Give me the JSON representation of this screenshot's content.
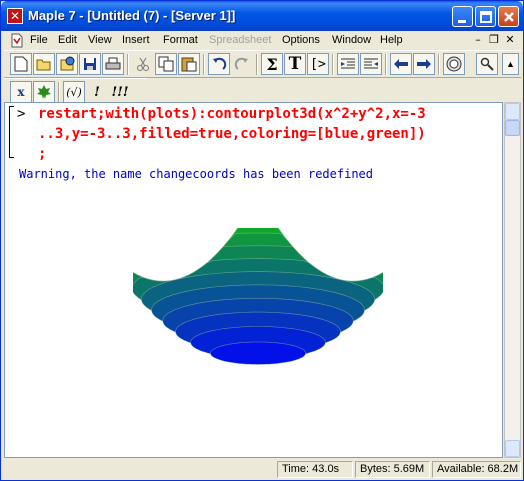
{
  "window": {
    "title": "Maple 7  - [Untitled (7) - [Server 1]]",
    "app_icon": "maple-leaf-icon",
    "title_color": "#0058e6"
  },
  "menu": {
    "items": [
      {
        "label": "File",
        "enabled": true
      },
      {
        "label": "Edit",
        "enabled": true
      },
      {
        "label": "View",
        "enabled": true
      },
      {
        "label": "Insert",
        "enabled": true
      },
      {
        "label": "Format",
        "enabled": true
      },
      {
        "label": "Spreadsheet",
        "enabled": false
      },
      {
        "label": "Options",
        "enabled": true
      },
      {
        "label": "Window",
        "enabled": true
      },
      {
        "label": "Help",
        "enabled": true
      }
    ]
  },
  "toolbar2": {
    "labels": [
      "x",
      "(√)",
      "!",
      "!!!"
    ]
  },
  "worksheet": {
    "prompt": ">",
    "command_lines": [
      "restart;with(plots):contourplot3d(x^2+y^2,x=-3",
      "..3,y=-3..3,filled=true,coloring=[blue,green])",
      ";"
    ],
    "warning": "Warning, the name changecoords has been redefined",
    "command_color": "#ff0000",
    "warning_color": "#0000c8"
  },
  "plot": {
    "function": "x^2+y^2",
    "x_range": [
      -3,
      3
    ],
    "y_range": [
      -3,
      3
    ],
    "filled": true,
    "coloring": [
      "blue",
      "green"
    ]
  },
  "status": {
    "time": "Time:  43.0s",
    "bytes": "Bytes: 5.69M",
    "available": "Available: 68.2M"
  }
}
